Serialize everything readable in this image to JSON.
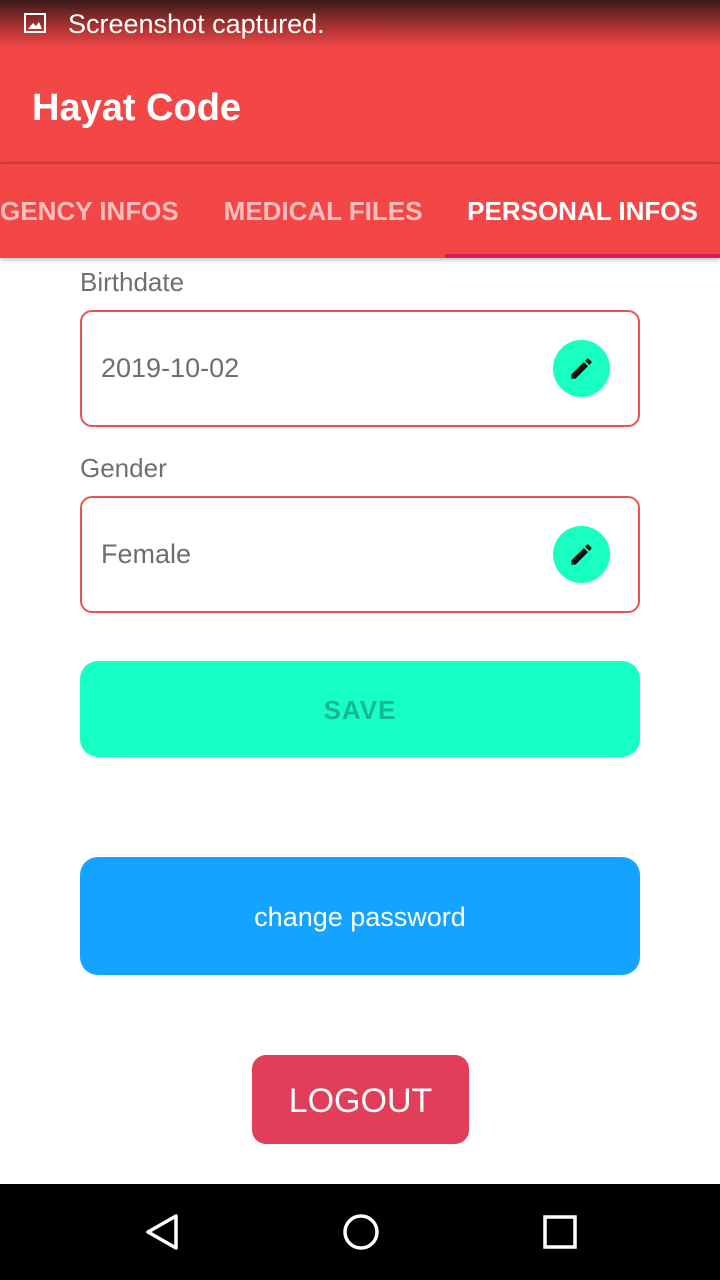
{
  "status_bar": {
    "notification_icon": "image-icon",
    "text": "Screenshot captured."
  },
  "app_bar": {
    "title": "Hayat Code"
  },
  "tabs": [
    {
      "label": "GENCY INFOS",
      "active": false
    },
    {
      "label": "MEDICAL FILES",
      "active": false
    },
    {
      "label": "PERSONAL INFOS",
      "active": true
    }
  ],
  "form": {
    "birthdate": {
      "label": "Birthdate",
      "value": "2019-10-02",
      "edit_icon": "pencil-icon"
    },
    "gender": {
      "label": "Gender",
      "value": "Female",
      "edit_icon": "pencil-icon"
    }
  },
  "buttons": {
    "save": "SAVE",
    "change_password": "change password",
    "logout": "LOGOUT"
  },
  "nav_bar": {
    "back_icon": "back-triangle-icon",
    "home_icon": "home-circle-icon",
    "recents_icon": "recents-square-icon"
  },
  "colors": {
    "primary": "#f34747",
    "tab_indicator": "#d81b60",
    "field_border": "#e85454",
    "edit_button": "#19ffc1",
    "save_button": "#16ffc4",
    "save_text": "#16b893",
    "change_password_button": "#14a3ff",
    "logout_button": "#e23e5a"
  }
}
